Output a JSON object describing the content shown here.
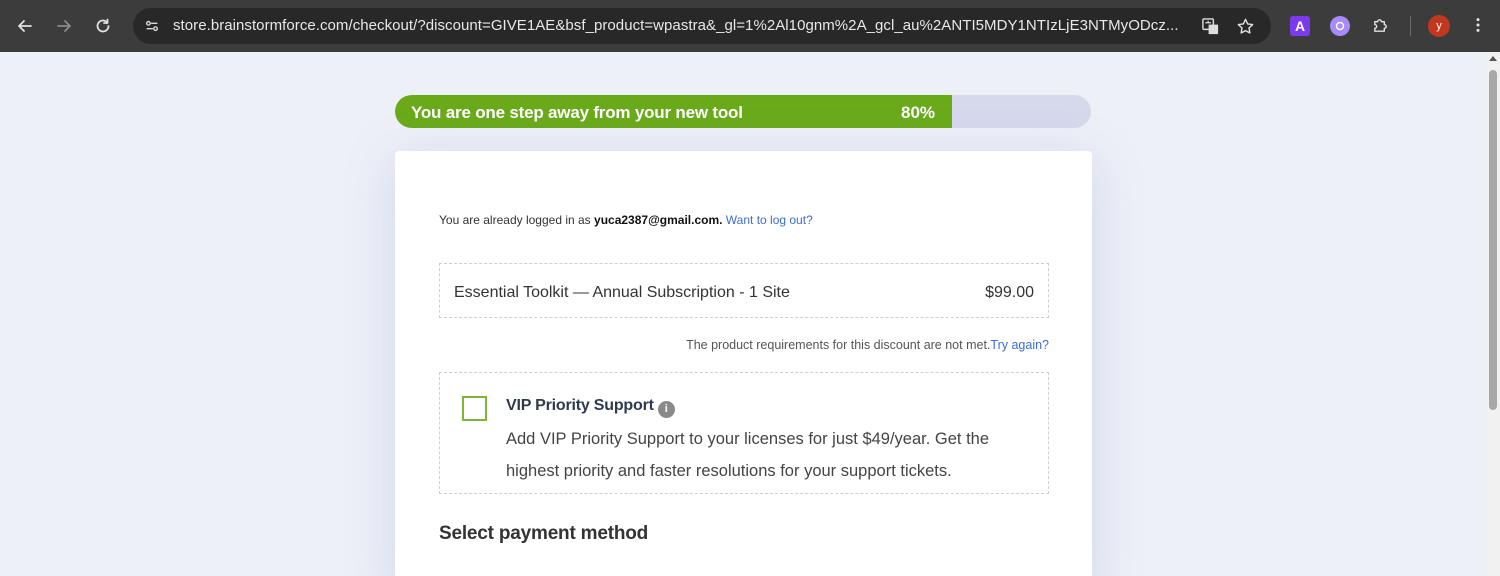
{
  "browser": {
    "url": "store.brainstormforce.com/checkout/?discount=GIVE1AE&bsf_product=wpastra&_gl=1%2Al10gnm%2A_gcl_au%2ANTI5MDY1NTIzLjE3NTMyODcz...",
    "avatar_initial": "y",
    "extension_a_label": "A"
  },
  "progress": {
    "label": "You are one step away from your new tool",
    "percent_label": "80%",
    "value": 0.8,
    "fill_color": "#6aaa1a"
  },
  "checkout": {
    "login_prefix": "You are already logged in as",
    "email": "yuca2387@gmail.com.",
    "logout_link": "Want to log out?",
    "product_name": "Essential Toolkit — Annual Subscription - 1 Site",
    "product_price": "$99.00",
    "discount_message": "The product requirements for this discount are not met.",
    "try_again_link": "Try again?",
    "vip_title": "VIP Priority Support",
    "vip_info_glyph": "i",
    "vip_description": "Add VIP Priority Support to your licenses for just $49/year. Get the highest priority and faster resolutions for your support tickets.",
    "payment_heading": "Select payment method"
  },
  "colors": {
    "accent_green": "#6aaa1a",
    "link_blue": "#3b6fd1"
  }
}
